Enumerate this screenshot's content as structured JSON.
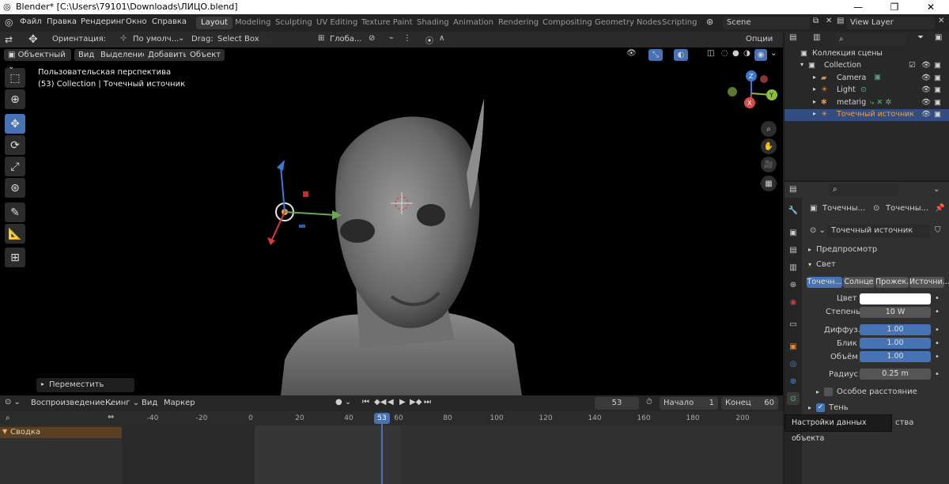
{
  "titlebar": {
    "title": "Blender* [C:\\Users\\79101\\Downloads\\ЛИЦО.blend]",
    "minimize": "—",
    "maximize": "❐",
    "close": "✕"
  },
  "menu": {
    "items": [
      "Файл",
      "Правка",
      "Рендеринг",
      "Окно",
      "Справка"
    ]
  },
  "workspaces": {
    "tabs": [
      "Layout",
      "Modeling",
      "Sculpting",
      "UV Editing",
      "Texture Paint",
      "Shading",
      "Animation",
      "Rendering",
      "Compositing",
      "Geometry Nodes",
      "Scripting"
    ],
    "active": "Layout"
  },
  "scene": {
    "name": "Scene",
    "view_layer": "View Layer"
  },
  "toolheader": {
    "orientation_label": "Ориентация:",
    "orientation_value": "По умолч...",
    "drag_label": "Drag:",
    "drag_value": "Select Box",
    "transform_value": "Глоба...",
    "options": "Опции"
  },
  "viewport": {
    "mode": "Объектный",
    "menus": [
      "Вид",
      "Выделение",
      "Добавить",
      "Объект"
    ],
    "info_line1": "Пользовательская перспектива",
    "info_line2": "(53) Collection | Точечный источник",
    "last_op": "Переместить",
    "gizmo": {
      "z": "Z",
      "y": "Y",
      "x": "X"
    }
  },
  "outliner": {
    "root": "Коллекция сцены",
    "collection": "Collection",
    "items": [
      {
        "name": "Camera",
        "selected": false
      },
      {
        "name": "Light",
        "selected": false
      },
      {
        "name": "metarig",
        "selected": false
      },
      {
        "name": "Точечный источник",
        "selected": true
      }
    ]
  },
  "properties": {
    "header_left": "Точечны...",
    "header_right": "Точечны...",
    "datablock": "Точечный источник",
    "preview_panel": "Предпросмотр",
    "light_panel": "Свет",
    "light_types": [
      "Точечн...",
      "Солнце",
      "Прожек...",
      "Источни..."
    ],
    "active_type": "Точечн...",
    "color_label": "Цвет",
    "color_value": "#ffffff",
    "power_label": "Степень",
    "power_value": "10 W",
    "diffuse_label": "Диффуз.",
    "diffuse_value": "1.00",
    "specular_label": "Блик",
    "specular_value": "1.00",
    "volume_label": "Объём",
    "volume_value": "1.00",
    "radius_label": "Радиус",
    "radius_value": "0.25 m",
    "custom_distance": "Особое расстояние",
    "shadow_panel": "Тень",
    "partial_panel": "ства"
  },
  "tooltip": "Настройки данных объекта",
  "timeline": {
    "playback": "Воспроизведение",
    "keying": "Кеинг",
    "view": "Вид",
    "marker": "Маркер",
    "current_frame": "53",
    "start_label": "Начало",
    "start_value": "1",
    "end_label": "Конец",
    "end_value": "60",
    "ticks": [
      "-40",
      "-20",
      "0",
      "20",
      "40",
      "60",
      "80",
      "100",
      "120",
      "140",
      "160",
      "180",
      "200"
    ],
    "playhead": "53",
    "summary": "Сводка"
  }
}
